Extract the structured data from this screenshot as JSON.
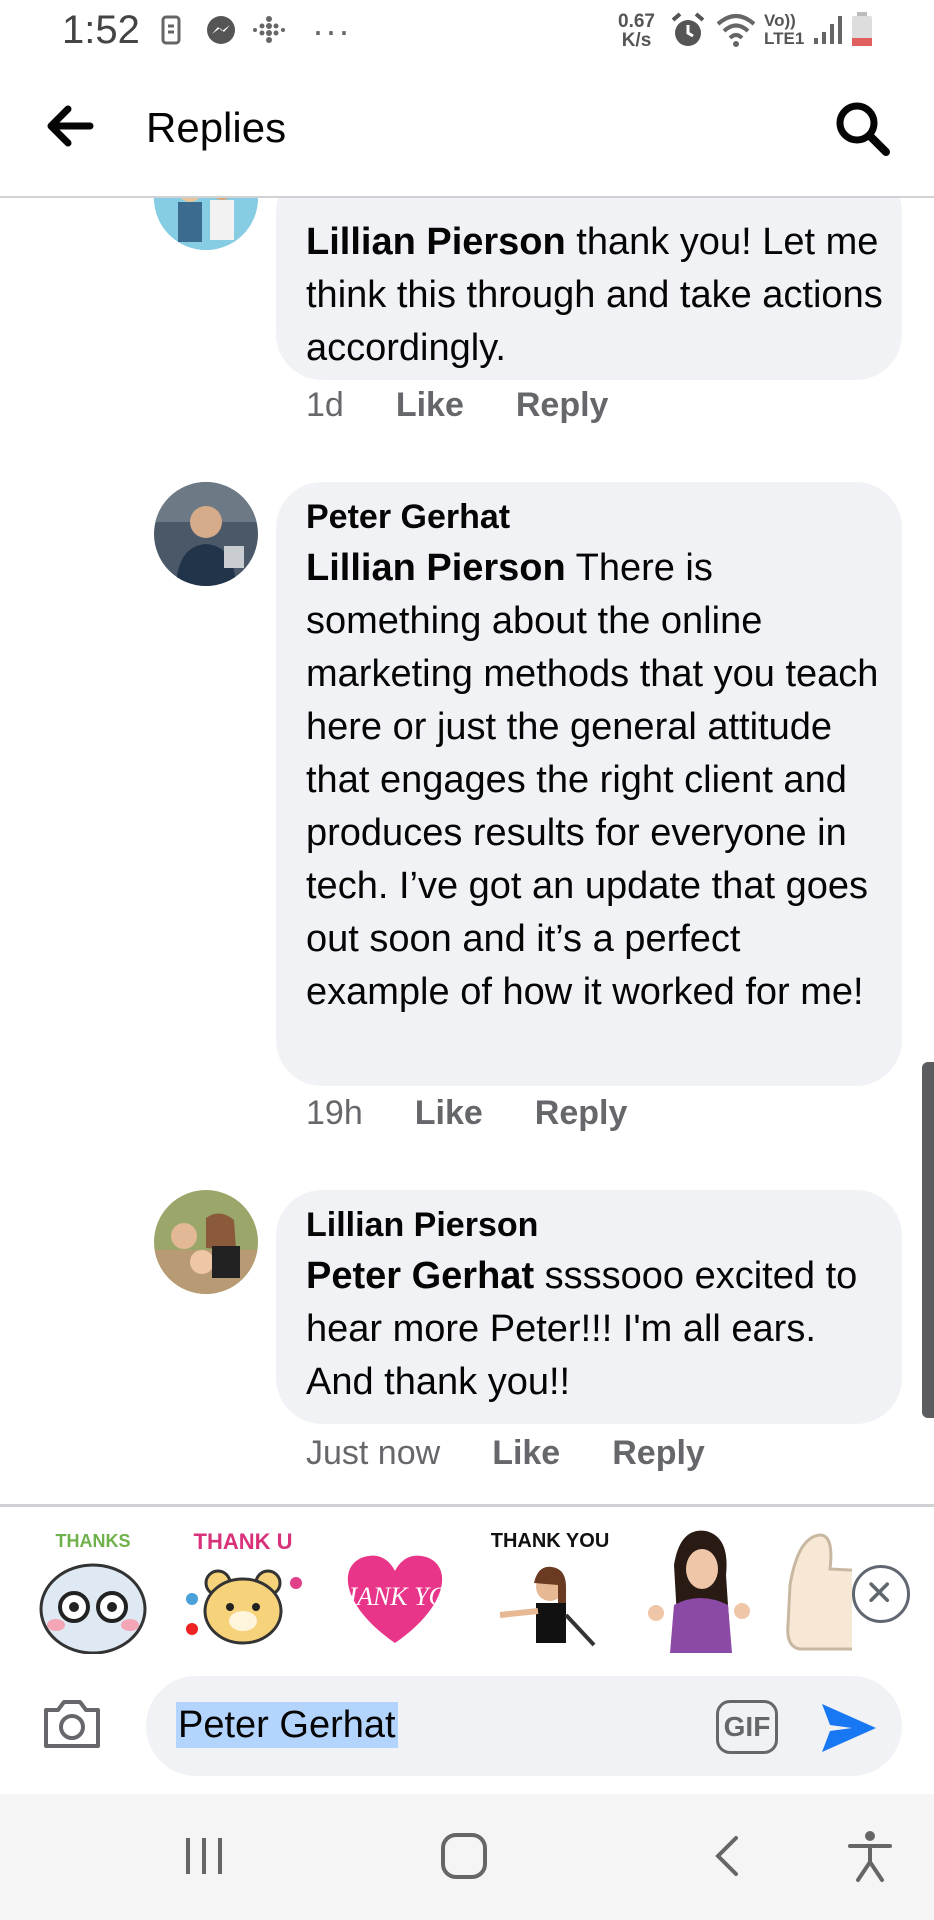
{
  "status_bar": {
    "time": "1:52",
    "net_speed_value": "0.67",
    "net_speed_unit": "K/s",
    "network_label_top": "Vo))",
    "network_label_bottom": "LTE1",
    "more": "···"
  },
  "header": {
    "title": "Replies",
    "back_icon": "arrow-left-icon",
    "search_icon": "search-icon"
  },
  "comments": [
    {
      "mention": "Lillian Pierson",
      "text": " thank you! Let me think this through and take actions accordingly.",
      "time": "1d",
      "like": "Like",
      "reply": "Reply"
    },
    {
      "author": "Peter Gerhat",
      "mention": "Lillian Pierson",
      "text": " There is something about the online marketing methods that you teach here or just the general attitude that engages the right client and produces results for everyone in tech. I’ve got an update that goes out soon and it’s a perfect example of how it worked for me!",
      "time": "19h",
      "like": "Like",
      "reply": "Reply"
    },
    {
      "author": "Lillian Pierson",
      "mention": "Peter Gerhat",
      "text": " ssssooo excited to hear more Peter!!! I'm all ears.    And thank you!!",
      "time": "Just now",
      "like": "Like",
      "reply": "Reply"
    }
  ],
  "stickers": {
    "items": [
      {
        "caption": "THANKS",
        "icon": "bear-glasses-sticker"
      },
      {
        "caption": "THANK U",
        "icon": "teddy-bear-sticker"
      },
      {
        "caption": "THANK YOU",
        "icon": "pink-heart-sticker"
      },
      {
        "caption": "THANK YOU",
        "icon": "woman-pointing-sticker"
      },
      {
        "caption": "",
        "icon": "woman-thumbs-up-sticker"
      },
      {
        "caption": "",
        "icon": "thumbs-up-sticker"
      }
    ],
    "close_icon": "close-circle-icon"
  },
  "composer": {
    "value": "Peter Gerhat",
    "gif_label": "GIF",
    "camera_icon": "camera-icon",
    "send_icon": "send-icon"
  },
  "colors": {
    "bubble": "#f0f2f5",
    "secondary_text": "#65676b",
    "accent": "#1877f2",
    "selection": "#b3d4fc"
  }
}
